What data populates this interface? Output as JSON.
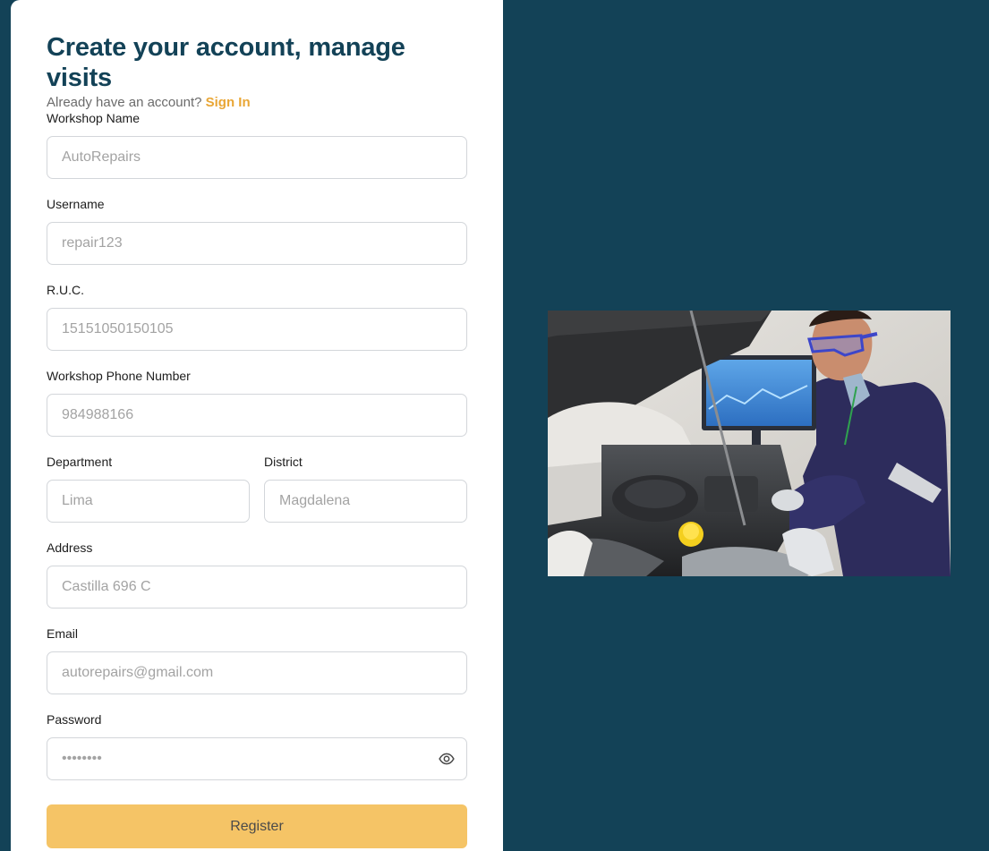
{
  "header": {
    "title": "Create your account, manage visits",
    "subtitle": "Already have an account?",
    "signin_label": "Sign In"
  },
  "form": {
    "workshop_name": {
      "label": "Workshop Name",
      "placeholder": "AutoRepairs"
    },
    "username": {
      "label": "Username",
      "placeholder": "repair123"
    },
    "ruc": {
      "label": "R.U.C.",
      "placeholder": "15151050150105"
    },
    "phone": {
      "label": "Workshop Phone Number",
      "placeholder": "984988166"
    },
    "department": {
      "label": "Department",
      "placeholder": "Lima"
    },
    "district": {
      "label": "District",
      "placeholder": "Magdalena"
    },
    "address": {
      "label": "Address",
      "placeholder": "Castilla 696 C"
    },
    "email": {
      "label": "Email",
      "placeholder": "autorepairs@gmail.com"
    },
    "password": {
      "label": "Password",
      "placeholder": "••••••••"
    },
    "register_label": "Register"
  },
  "icons": {
    "password_toggle": "eye-icon"
  },
  "colors": {
    "background": "#134257",
    "title": "#134257",
    "link": "#e9a635",
    "button": "#f5c466"
  }
}
